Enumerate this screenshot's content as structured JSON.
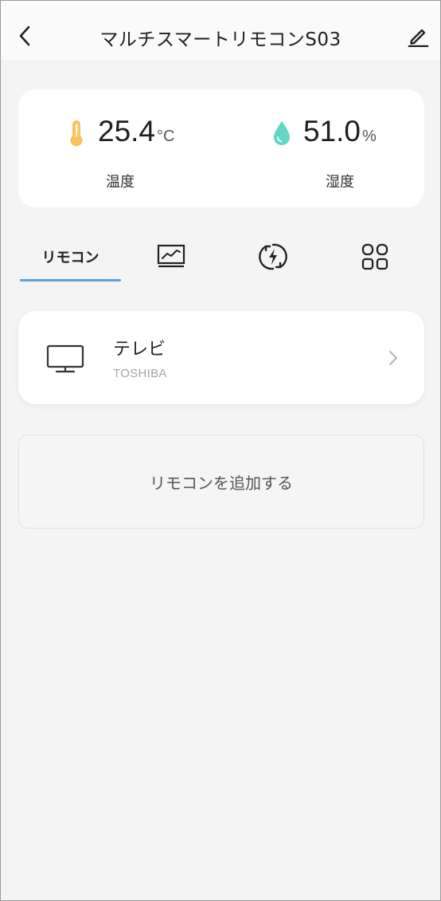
{
  "header": {
    "title": "マルチスマートリモコンS03",
    "back_icon": "back-chevron-icon",
    "edit_icon": "pencil-icon"
  },
  "sensors": {
    "temperature": {
      "value": "25.4",
      "unit": "°C",
      "label": "温度",
      "icon": "thermometer-icon",
      "color": "#f5c35a"
    },
    "humidity": {
      "value": "51.0",
      "unit": "%",
      "label": "湿度",
      "icon": "water-drop-icon",
      "color": "#63d6c5"
    }
  },
  "tabs": [
    {
      "label": "リモコン",
      "active": true
    },
    {
      "icon": "chart-monitor-icon"
    },
    {
      "icon": "power-cycle-icon"
    },
    {
      "icon": "grid-apps-icon"
    }
  ],
  "devices": [
    {
      "name": "テレビ",
      "brand": "TOSHIBA",
      "icon": "tv-icon"
    }
  ],
  "add_remote": {
    "label": "リモコンを追加する"
  },
  "colors": {
    "accent": "#5aa0e6",
    "background": "#f4f4f4"
  }
}
